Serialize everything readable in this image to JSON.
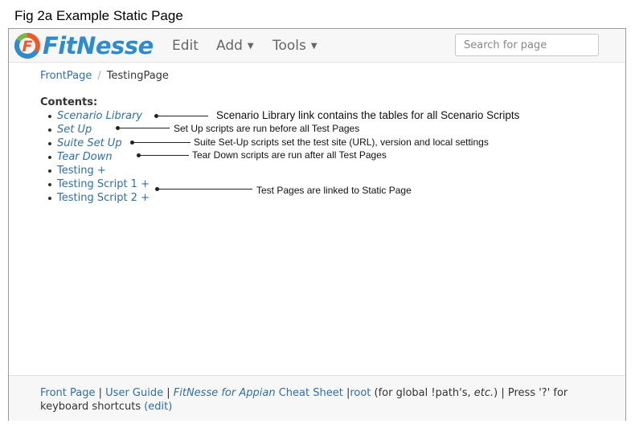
{
  "caption": "Fig 2a  Example Static Page",
  "app": {
    "logo_text": "FitNesse",
    "nav": {
      "edit": "Edit",
      "add": "Add",
      "tools": "Tools"
    },
    "search": {
      "placeholder": "Search for page"
    }
  },
  "breadcrumb": {
    "root": "FrontPage",
    "separator": "/",
    "current": "TestingPage"
  },
  "contents": {
    "title": "Contents:",
    "items": [
      {
        "label": "Scenario Library",
        "suffix": ""
      },
      {
        "label": "Set Up",
        "suffix": ""
      },
      {
        "label": "Suite Set Up",
        "suffix": ""
      },
      {
        "label": "Tear Down",
        "suffix": ""
      },
      {
        "label": "Testing",
        "suffix": "+"
      },
      {
        "label": "Testing Script 1",
        "suffix": "+"
      },
      {
        "label": "Testing Script 2",
        "suffix": "+"
      }
    ]
  },
  "annotations": {
    "scenario": "Scenario Library link contains the tables for all Scenario Scripts",
    "setup": "Set Up scripts are run before all Test Pages",
    "suite": "Suite Set-Up scripts set the test site (URL), version and local settings",
    "teardown": "Tear Down scripts are run after all Test Pages",
    "tests": "Test Pages are linked to Static Page"
  },
  "footer": {
    "front_page": "Front Page",
    "sep": " | ",
    "user_guide": "User Guide",
    "fitnesse_for": "FitNesse for Appian",
    "cheat_sheet": " Cheat Sheet",
    "pipe": " |",
    "root": "root",
    "root_note_pre": " (for global !path's, ",
    "etc": "etc.",
    "root_note_post": ") | Press '?' for keyboard shortcuts ",
    "edit": "(edit)"
  },
  "colors": {
    "link": "#2e6fa8",
    "logo_blue": "#2d8ccf",
    "logo_orange": "#f0592a",
    "logo_green": "#7ab648"
  }
}
